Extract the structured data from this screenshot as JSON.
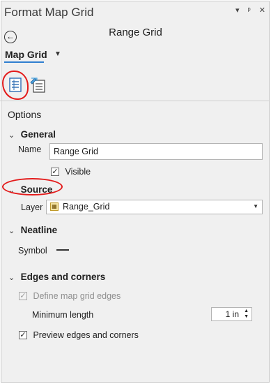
{
  "window": {
    "title": "Format Map Grid",
    "controls": [
      "▾",
      "ᵖ",
      "✕"
    ]
  },
  "header": {
    "title": "Range Grid",
    "back_icon": "back-arrow-icon"
  },
  "element_selector": {
    "value": "Map Grid"
  },
  "tabs": [
    {
      "name": "options-tab",
      "icon": "properties-icon"
    },
    {
      "name": "display-tab",
      "icon": "grid-display-icon"
    }
  ],
  "options": {
    "heading": "Options",
    "general": {
      "heading": "General",
      "name_label": "Name",
      "name_value": "Range Grid",
      "visible_label": "Visible",
      "visible_checked": true
    },
    "source": {
      "heading": "Source",
      "layer_label": "Layer",
      "layer_value": "Range_Grid"
    },
    "neatline": {
      "heading": "Neatline",
      "symbol_label": "Symbol"
    },
    "edges": {
      "heading": "Edges and corners",
      "define_label": "Define map grid edges",
      "define_checked": true,
      "define_enabled": false,
      "min_length_label": "Minimum length",
      "min_length_value": "1 in",
      "preview_label": "Preview edges and corners",
      "preview_checked": true
    }
  },
  "colors": {
    "accent": "#2f7fd0",
    "annotation": "#e31b1b",
    "panel_bg": "#f0f0f0"
  }
}
